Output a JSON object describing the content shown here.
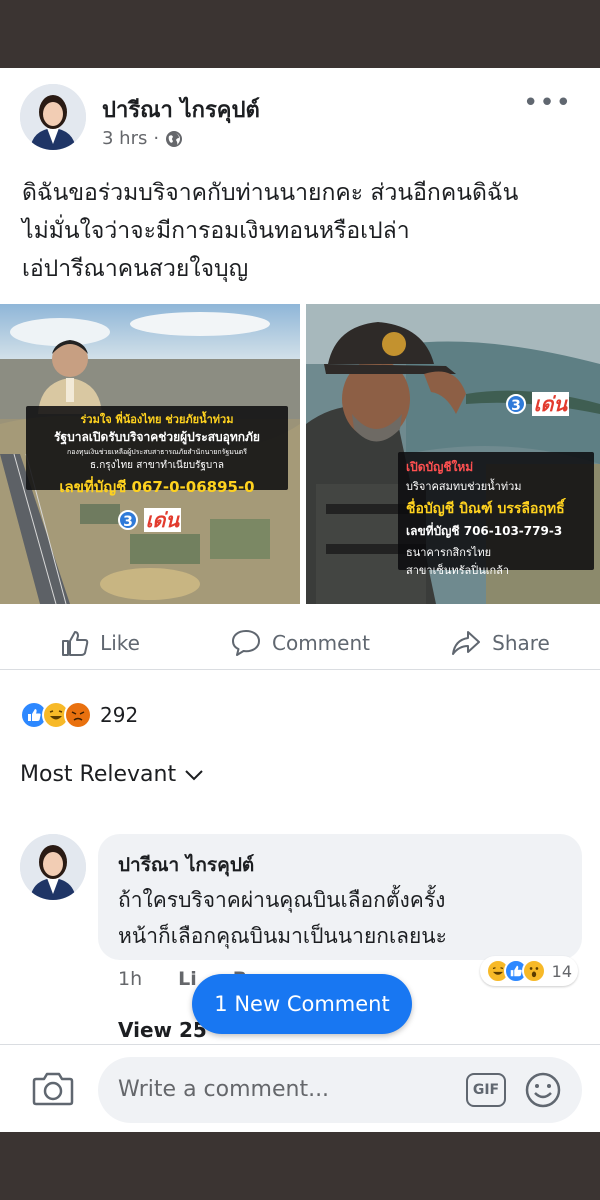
{
  "post": {
    "author": "ปารีณา ไกรคุปต์",
    "time": "3 hrs",
    "separator": "·",
    "text_lines": [
      "ดิฉันขอร่วมบริจาคกับท่านนายกคะ ส่วนอีกคนดิฉัน",
      "ไม่มั่นใจว่าจะมีการอมเงินทอนหรือเปล่า",
      "เอ่ปารีณาคนสวยใจบุญ"
    ]
  },
  "images": {
    "left": {
      "line1": "ร่วมใจ พี่น้องไทย ช่วยภัยน้ำท่วม",
      "line2": "รัฐบาลเปิดรับบริจาคช่วยผู้ประสบอุทกภัย",
      "line3": "กองทุนเงินช่วยเหลือผู้ประสบสาธารณภัยสำนักนายกรัฐมนตรี",
      "line4": "ธ.กรุงไทย สาขาทำเนียบรัฐบาล",
      "account": "เลขที่บัญชี 067-0-06895-0",
      "logo_number": "3",
      "logo_word": "เด่น"
    },
    "right": {
      "line1": "เปิดบัญชีใหม่",
      "line2": "บริจาคสมทบช่วยน้ำท่วม",
      "name": "ชื่อบัญชี บิณฑ์ บรรลือฤทธิ์",
      "account": "เลขที่บัญชี 706-103-779-3",
      "bank": "ธนาคารกสิกรไทย",
      "branch": "สาขาเซ็นทรัลปิ่นเกล้า",
      "logo_number": "3",
      "logo_word": "เด่น"
    }
  },
  "actions": {
    "like": "Like",
    "comment": "Comment",
    "share": "Share"
  },
  "reactions": {
    "count": "292",
    "types": [
      "like",
      "haha",
      "angry"
    ]
  },
  "sort": {
    "label": "Most Relevant"
  },
  "comment": {
    "author": "ปารีณา ไกรคุปต์",
    "text_lines": [
      "ถ้าใครบริจาคผ่านคุณบินเลือกตั้งครั้ง",
      "หน้าก็เลือกคุณบินมาเป็นนายกเลยนะ"
    ],
    "time": "1h",
    "like": "Li",
    "reply": "Re",
    "reaction_count": "14",
    "reaction_types": [
      "haha",
      "like",
      "wow"
    ],
    "view_replies": "View 25"
  },
  "new_comment_pill": "1 New Comment",
  "composer": {
    "placeholder": "Write a comment...",
    "gif": "GIF"
  },
  "colors": {
    "facebook_blue": "#1877f2",
    "like_blue": "#2d88ff",
    "haha_yellow": "#f7b928",
    "angry_orange": "#e9710f",
    "frame_dark": "#3b3432"
  },
  "icons": [
    "globe-icon",
    "more-icon",
    "like-icon",
    "comment-icon",
    "share-icon",
    "chevron-down-icon",
    "camera-icon",
    "gif-icon",
    "emoji-icon"
  ]
}
